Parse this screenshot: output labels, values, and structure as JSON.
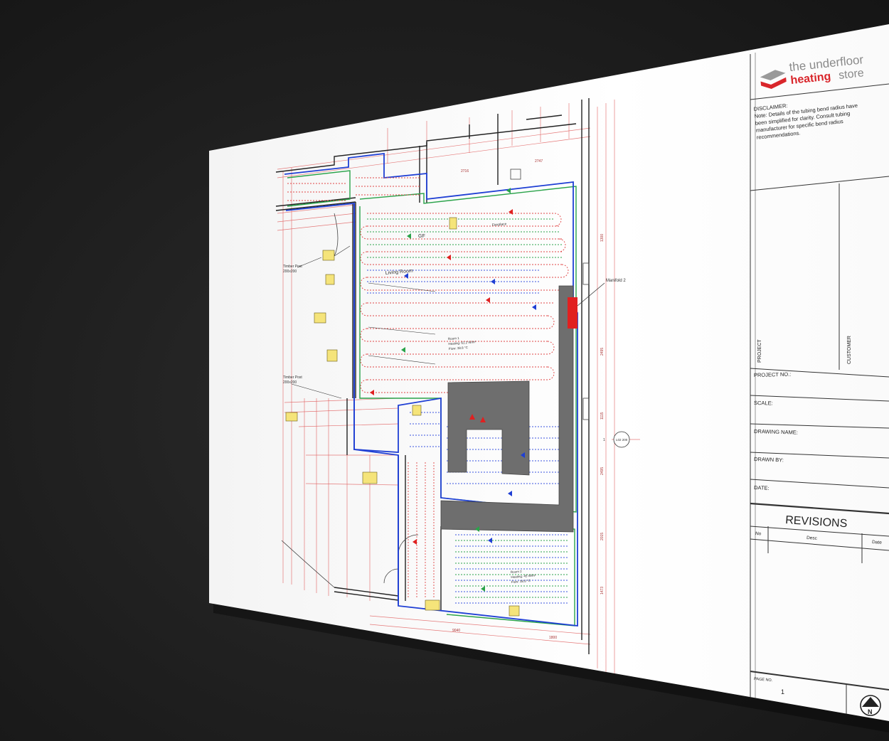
{
  "brand": {
    "line1": "the underfloor",
    "line2_bold": "heating",
    "line2_light": "store",
    "colors": {
      "red": "#d9262b",
      "grey": "#8a8a8a",
      "dark": "#555555"
    }
  },
  "disclaimer": {
    "heading": "DISCLAIMER:",
    "lines": [
      "Note: Details of the tubing bend radius have",
      "been simplified for clarity. Consult tubing",
      "manufacturer for specific bend radius",
      "recommendations."
    ]
  },
  "title_block": {
    "project_label": "PROJECT",
    "customer_label": "CUSTOMER",
    "project_no_label": "PROJECT NO.:",
    "scale_label": "SCALE:",
    "drawing_name_label": "DRAWING NAME:",
    "drawn_by_label": "DRAWN BY:",
    "date_label": "DATE:"
  },
  "revisions": {
    "title": "REVISIONS",
    "columns": [
      "No",
      "Desc",
      "Date"
    ]
  },
  "page": {
    "label": "PAGE NO.",
    "number": "1",
    "north": "N"
  },
  "plan": {
    "labels": {
      "gf": "GF",
      "living_room": "Living Room",
      "fireplace": "Fireplace",
      "timber_post_1": "Timber Post",
      "timber_post_1_size": "200x200",
      "timber_post_2": "Timber Post",
      "timber_post_2_size": "200x200",
      "manifold": "Manifold 2",
      "room_1": "Room 1",
      "room_1_heating": "Heating: 61.2 W/m²",
      "room_1_flow": "Flow: 38.8 °C",
      "room_2": "Room 2",
      "room_2_heating": "Heating: 45 W/m²",
      "room_2_flow": "Flow: 38.8 °C",
      "section": "1",
      "section_ref": "L02 200"
    },
    "dimensions": [
      "2716",
      "2747",
      "1300",
      "2495",
      "1115",
      "2495",
      "2015",
      "1473",
      "9040",
      "1800"
    ]
  }
}
